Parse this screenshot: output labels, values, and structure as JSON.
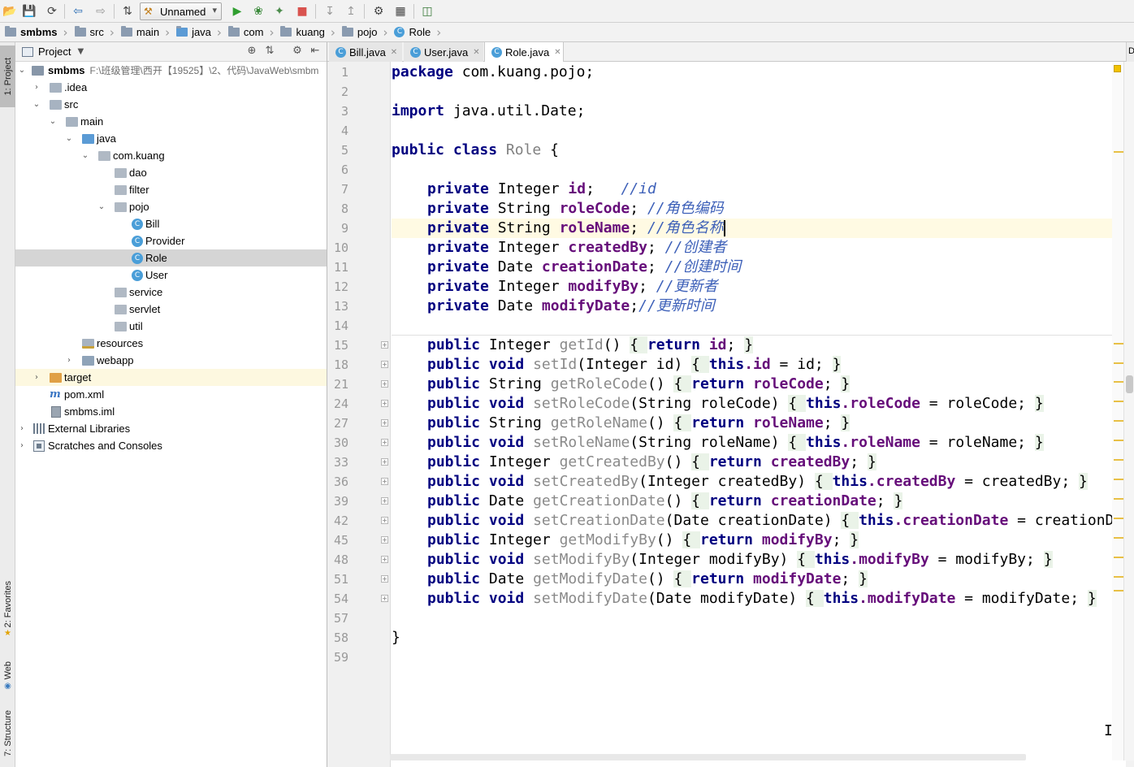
{
  "toolbar": {
    "run_config": "Unnamed"
  },
  "breadcrumb": [
    "smbms",
    "src",
    "main",
    "java",
    "com",
    "kuang",
    "pojo",
    "Role"
  ],
  "left_strip": {
    "project_tab": "1: Project",
    "favorites_tab": "2: Favorites",
    "web_tab": "Web",
    "structure_tab": "7: Structure"
  },
  "project_panel": {
    "title": "Project",
    "root_name": "smbms",
    "root_path": "F:\\班级管理\\西开【19525】\\2、代码\\JavaWeb\\smbm",
    "items": {
      "idea": ".idea",
      "src": "src",
      "main": "main",
      "java": "java",
      "com_kuang": "com.kuang",
      "dao": "dao",
      "filter": "filter",
      "pojo": "pojo",
      "bill": "Bill",
      "provider": "Provider",
      "role": "Role",
      "user": "User",
      "service": "service",
      "servlet": "servlet",
      "util": "util",
      "resources": "resources",
      "webapp": "webapp",
      "target": "target",
      "pom": "pom.xml",
      "iml": "smbms.iml",
      "ext_libs": "External Libraries",
      "scratches": "Scratches and Consoles"
    }
  },
  "tabs": [
    {
      "label": "Bill.java"
    },
    {
      "label": "User.java"
    },
    {
      "label": "Role.java"
    }
  ],
  "right_strip_label": "D",
  "editor": {
    "line_numbers": [
      "1",
      "2",
      "3",
      "4",
      "5",
      "6",
      "7",
      "8",
      "9",
      "10",
      "11",
      "12",
      "13",
      "14",
      "15",
      "18",
      "21",
      "24",
      "27",
      "30",
      "33",
      "36",
      "39",
      "42",
      "45",
      "48",
      "51",
      "54",
      "57",
      "58",
      "59"
    ],
    "code": {
      "l1_kw": "package",
      "l1_rest": " com.kuang.pojo;",
      "l3_kw": "import",
      "l3_rest": " java.util.Date;",
      "l5_kw": "public class",
      "l5_cls": "Role",
      "l5_rest": " {",
      "f_private": "private",
      "l7_type": " Integer ",
      "l7_field": "id",
      "l7_semi": ";   ",
      "l7_comment": "//id",
      "l8_type": " String ",
      "l8_field": "roleCode",
      "l8_semi": "; ",
      "l8_comment": "//角色编码",
      "l9_type": " String ",
      "l9_field": "roleName",
      "l9_semi": "; ",
      "l9_comment": "//角色名称",
      "l10_type": " Integer ",
      "l10_field": "createdBy",
      "l10_semi": "; ",
      "l10_comment": "//创建者",
      "l11_type": " Date ",
      "l11_field": "creationDate",
      "l11_semi": "; ",
      "l11_comment": "//创建时间",
      "l12_type": " Integer ",
      "l12_field": "modifyBy",
      "l12_semi": "; ",
      "l12_comment": "//更新者",
      "l13_type": " Date ",
      "l13_field": "modifyDate",
      "l13_semi": ";",
      "l13_comment": "//更新时间",
      "kw_public": "public",
      "kw_void": "void",
      "kw_return": "return",
      "kw_this": "this",
      "l15": {
        "type": " Integer ",
        "name": "getId",
        "sig": "() ",
        "ob": "{ ",
        "field": "id",
        "tail": "; ",
        "cb": "}"
      },
      "l18": {
        "name": "setId",
        "sig": "(Integer id) ",
        "ob": "{ ",
        "field": ".id",
        "tail": " = id; ",
        "cb": "}"
      },
      "l21": {
        "type": " String ",
        "name": "getRoleCode",
        "sig": "() ",
        "ob": "{ ",
        "field": "roleCode",
        "tail": "; ",
        "cb": "}"
      },
      "l24": {
        "name": "setRoleCode",
        "sig": "(String roleCode) ",
        "ob": "{ ",
        "field": ".roleCode",
        "tail": " = roleCode; ",
        "cb": "}"
      },
      "l27": {
        "type": " String ",
        "name": "getRoleName",
        "sig": "() ",
        "ob": "{ ",
        "field": "roleName",
        "tail": "; ",
        "cb": "}"
      },
      "l30": {
        "name": "setRoleName",
        "sig": "(String roleName) ",
        "ob": "{ ",
        "field": ".roleName",
        "tail": " = roleName; ",
        "cb": "}"
      },
      "l33": {
        "type": " Integer ",
        "name": "getCreatedBy",
        "sig": "() ",
        "ob": "{ ",
        "field": "createdBy",
        "tail": "; ",
        "cb": "}"
      },
      "l36": {
        "name": "setCreatedBy",
        "sig": "(Integer createdBy) ",
        "ob": "{ ",
        "field": ".createdBy",
        "tail": " = createdBy; ",
        "cb": "}"
      },
      "l39": {
        "type": " Date ",
        "name": "getCreationDate",
        "sig": "() ",
        "ob": "{ ",
        "field": "creationDate",
        "tail": "; ",
        "cb": "}"
      },
      "l42": {
        "name": "setCreationDate",
        "sig": "(Date creationDate) ",
        "ob": "{ ",
        "field": ".creationDate",
        "tail": " = creationD",
        "cb": ""
      },
      "l45": {
        "type": " Integer ",
        "name": "getModifyBy",
        "sig": "() ",
        "ob": "{ ",
        "field": "modifyBy",
        "tail": "; ",
        "cb": "}"
      },
      "l48": {
        "name": "setModifyBy",
        "sig": "(Integer modifyBy) ",
        "ob": "{ ",
        "field": ".modifyBy",
        "tail": " = modifyBy; ",
        "cb": "}"
      },
      "l51": {
        "type": " Date ",
        "name": "getModifyDate",
        "sig": "() ",
        "ob": "{ ",
        "field": "modifyDate",
        "tail": "; ",
        "cb": "}"
      },
      "l54": {
        "name": "setModifyDate",
        "sig": "(Date modifyDate) ",
        "ob": "{ ",
        "field": ".modifyDate",
        "tail": " = modifyDate; ",
        "cb": "}"
      },
      "l58": "}"
    }
  }
}
